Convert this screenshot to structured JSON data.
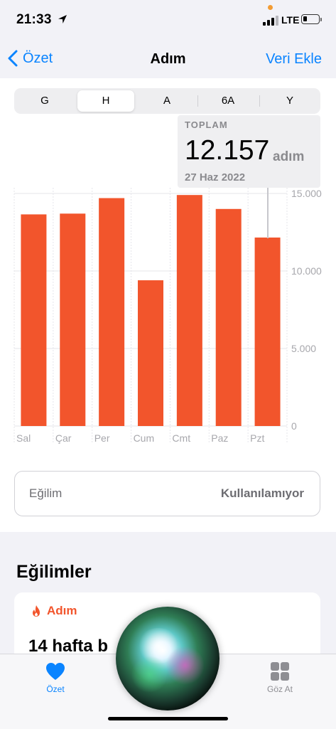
{
  "status_bar": {
    "time": "21:33",
    "network": "LTE"
  },
  "nav": {
    "back_label": "Özet",
    "title": "Adım",
    "right_label": "Veri Ekle"
  },
  "segments": [
    {
      "label": "G",
      "active": false
    },
    {
      "label": "H",
      "active": true
    },
    {
      "label": "A",
      "active": false
    },
    {
      "label": "6A",
      "active": false
    },
    {
      "label": "Y",
      "active": false
    }
  ],
  "popover": {
    "label": "TOPLAM",
    "value": "12.157",
    "unit": "adım",
    "date": "27 Haz 2022"
  },
  "colors": {
    "bar": "#f2552c",
    "accent": "#0a84ff",
    "grid": "#e5e5ea",
    "axis_text": "#a7a7ac"
  },
  "chart_data": {
    "type": "bar",
    "categories": [
      "Sal",
      "Çar",
      "Per",
      "Cum",
      "Cmt",
      "Paz",
      "Pzt"
    ],
    "values": [
      13650,
      13700,
      14700,
      9400,
      14900,
      14000,
      12157
    ],
    "ylim": [
      0,
      15000
    ],
    "yticks": [
      0,
      5000,
      10000,
      15000
    ],
    "ytick_labels": [
      "0",
      "5.000",
      "10.000",
      "15.000"
    ],
    "grid": true,
    "selected_index": 6
  },
  "trend_row": {
    "label": "Eğilim",
    "value": "Kullanılamıyor"
  },
  "trends": {
    "heading": "Eğilimler",
    "card_title": "Adım",
    "card_body": "14 hafta b"
  },
  "tabs": [
    {
      "label": "Özet",
      "icon": "heart-icon",
      "active": true
    },
    {
      "label": "Göz At",
      "icon": "grid-icon",
      "active": false
    }
  ]
}
